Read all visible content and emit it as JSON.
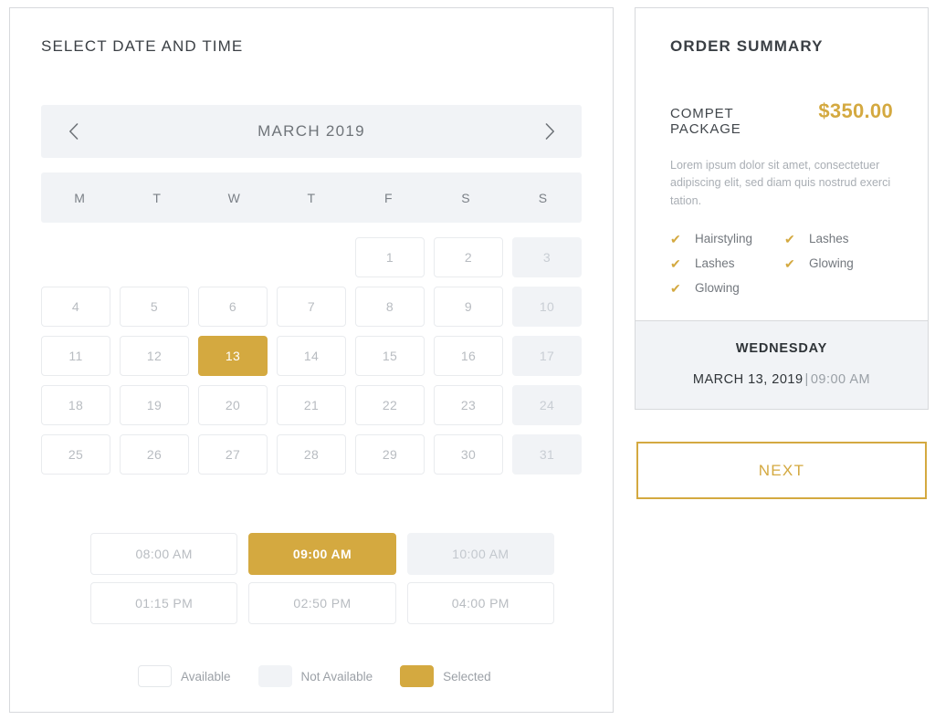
{
  "scheduler": {
    "title": "SELECT DATE AND TIME",
    "prev_icon": "chevron-left-icon",
    "next_icon": "chevron-right-icon",
    "month_label": "MARCH 2019",
    "weekdays": [
      "M",
      "T",
      "W",
      "T",
      "F",
      "S",
      "S"
    ],
    "leading_blanks": 4,
    "days": [
      {
        "n": "1",
        "state": "available"
      },
      {
        "n": "2",
        "state": "available"
      },
      {
        "n": "3",
        "state": "unavailable"
      },
      {
        "n": "4",
        "state": "available"
      },
      {
        "n": "5",
        "state": "available"
      },
      {
        "n": "6",
        "state": "available"
      },
      {
        "n": "7",
        "state": "available"
      },
      {
        "n": "8",
        "state": "available"
      },
      {
        "n": "9",
        "state": "available"
      },
      {
        "n": "10",
        "state": "unavailable"
      },
      {
        "n": "11",
        "state": "available"
      },
      {
        "n": "12",
        "state": "available"
      },
      {
        "n": "13",
        "state": "selected"
      },
      {
        "n": "14",
        "state": "available"
      },
      {
        "n": "15",
        "state": "available"
      },
      {
        "n": "16",
        "state": "available"
      },
      {
        "n": "17",
        "state": "unavailable"
      },
      {
        "n": "18",
        "state": "available"
      },
      {
        "n": "19",
        "state": "available"
      },
      {
        "n": "20",
        "state": "available"
      },
      {
        "n": "21",
        "state": "available"
      },
      {
        "n": "22",
        "state": "available"
      },
      {
        "n": "23",
        "state": "available"
      },
      {
        "n": "24",
        "state": "unavailable"
      },
      {
        "n": "25",
        "state": "available"
      },
      {
        "n": "26",
        "state": "available"
      },
      {
        "n": "27",
        "state": "available"
      },
      {
        "n": "28",
        "state": "available"
      },
      {
        "n": "29",
        "state": "available"
      },
      {
        "n": "30",
        "state": "available"
      },
      {
        "n": "31",
        "state": "unavailable"
      }
    ],
    "time_slots": [
      {
        "label": "08:00 AM",
        "state": "available"
      },
      {
        "label": "09:00 AM",
        "state": "selected"
      },
      {
        "label": "10:00 AM",
        "state": "unavailable"
      },
      {
        "label": "01:15 PM",
        "state": "available"
      },
      {
        "label": "02:50 PM",
        "state": "available"
      },
      {
        "label": "04:00 PM",
        "state": "available"
      }
    ],
    "legend": [
      {
        "label": "Available",
        "state": "available"
      },
      {
        "label": "Not Available",
        "state": "unavailable"
      },
      {
        "label": "Selected",
        "state": "selected"
      }
    ]
  },
  "summary": {
    "title": "ORDER SUMMARY",
    "package_name": "COMPET PACKAGE",
    "package_price": "$350.00",
    "description": "Lorem ipsum dolor sit amet, consectetuer adipiscing elit, sed diam quis nostrud exerci tation.",
    "check_icon": "check-icon",
    "features": [
      "Hairstyling",
      "Lashes",
      "Lashes",
      "Glowing",
      "Glowing"
    ],
    "footer_day": "WEDNESDAY",
    "footer_date": "MARCH 13, 2019",
    "footer_separator": "|",
    "footer_time": "09:00 AM"
  },
  "actions": {
    "next_label": "NEXT"
  },
  "colors": {
    "accent_gold": "#d4a940",
    "panel_border": "#d7d9dc",
    "muted_grey_bg": "#f1f3f6",
    "text_dark": "#3a3f44",
    "text_muted": "#b8bcc1"
  }
}
